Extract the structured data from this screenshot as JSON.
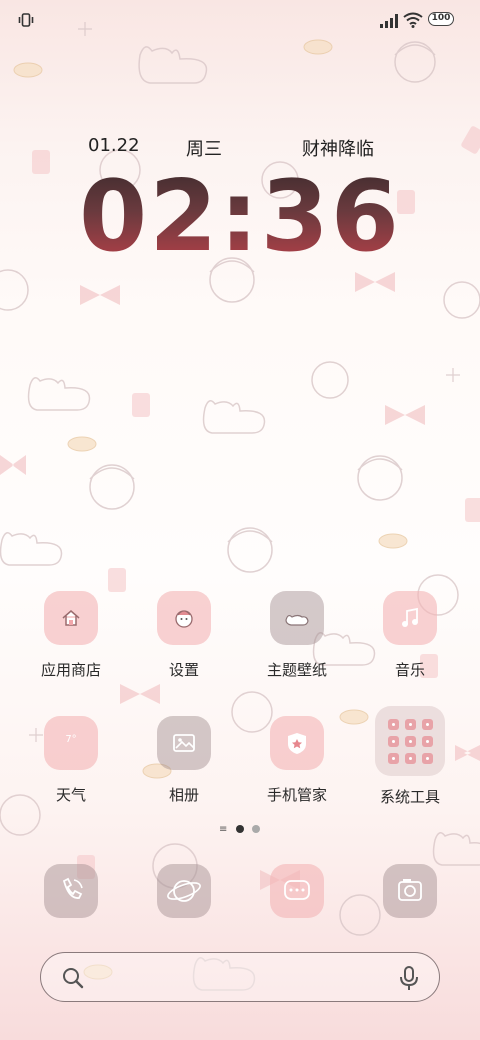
{
  "status_bar": {
    "battery": "100"
  },
  "lockscreen": {
    "date": "01.22",
    "weekday": "周三",
    "greeting": "财神降临",
    "time": "02:36"
  },
  "apps": [
    {
      "label": "应用商店",
      "icon": "app-store-icon"
    },
    {
      "label": "设置",
      "icon": "settings-icon"
    },
    {
      "label": "主题壁纸",
      "icon": "theme-icon"
    },
    {
      "label": "音乐",
      "icon": "music-icon"
    },
    {
      "label": "天气",
      "icon": "weather-icon",
      "value": "7°"
    },
    {
      "label": "相册",
      "icon": "gallery-icon"
    },
    {
      "label": "手机管家",
      "icon": "phone-manager-icon"
    },
    {
      "label": "系统工具",
      "icon": "folder-icon"
    }
  ],
  "dock": [
    {
      "icon": "phone-icon"
    },
    {
      "icon": "browser-icon"
    },
    {
      "icon": "messages-icon"
    },
    {
      "icon": "camera-icon"
    }
  ],
  "colors": {
    "accent": "#c0414a",
    "tile_pink": "#f4b4b6",
    "tile_gray": "#a08c8e"
  }
}
